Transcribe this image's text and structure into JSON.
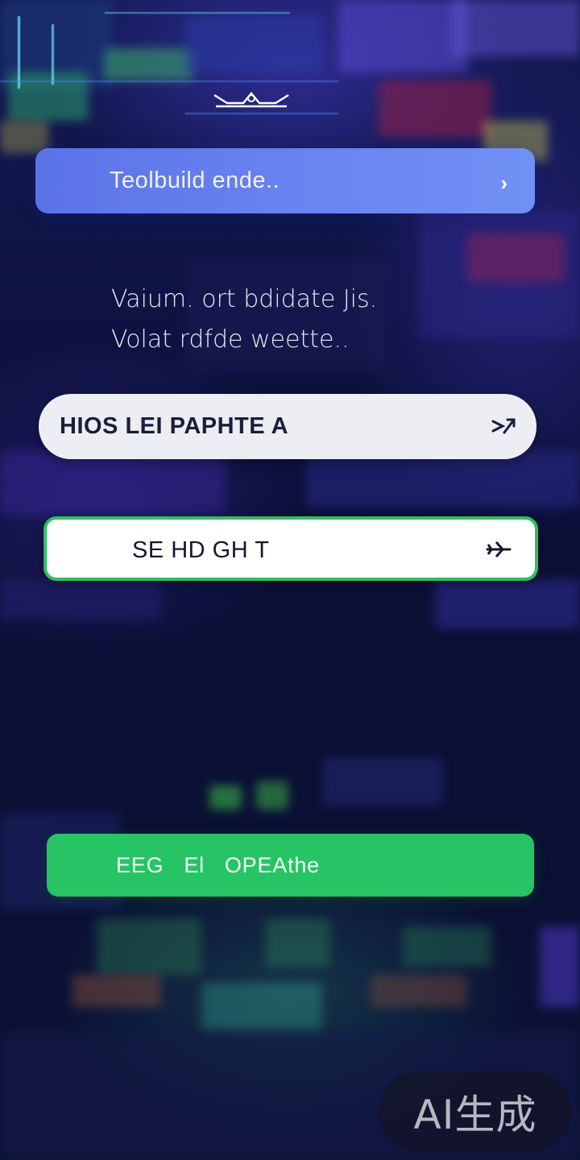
{
  "app": {
    "top_bar_label": "Teolbuild ende..",
    "top_bar_chevron": "›",
    "description_line1": "Vaium. ort bdidate Jis.",
    "description_line2": "Volat rdfde weette.."
  },
  "buttons": {
    "white_label": "HIOS LEI PAPHTE A",
    "outline_label": "SE HD GH T",
    "green_label": "EEG   El   OPEAthe"
  },
  "watermark": {
    "text": "AI生成"
  },
  "colors": {
    "top_bar": "#6a84f0",
    "green_accent": "#26c465",
    "outline_border": "#2fbf63",
    "background": "#0b0f2e"
  },
  "icons": {
    "top_bar": "chevron-right-icon",
    "white_button": "arrow-right-icon",
    "outline_button": "airplane-icon"
  }
}
